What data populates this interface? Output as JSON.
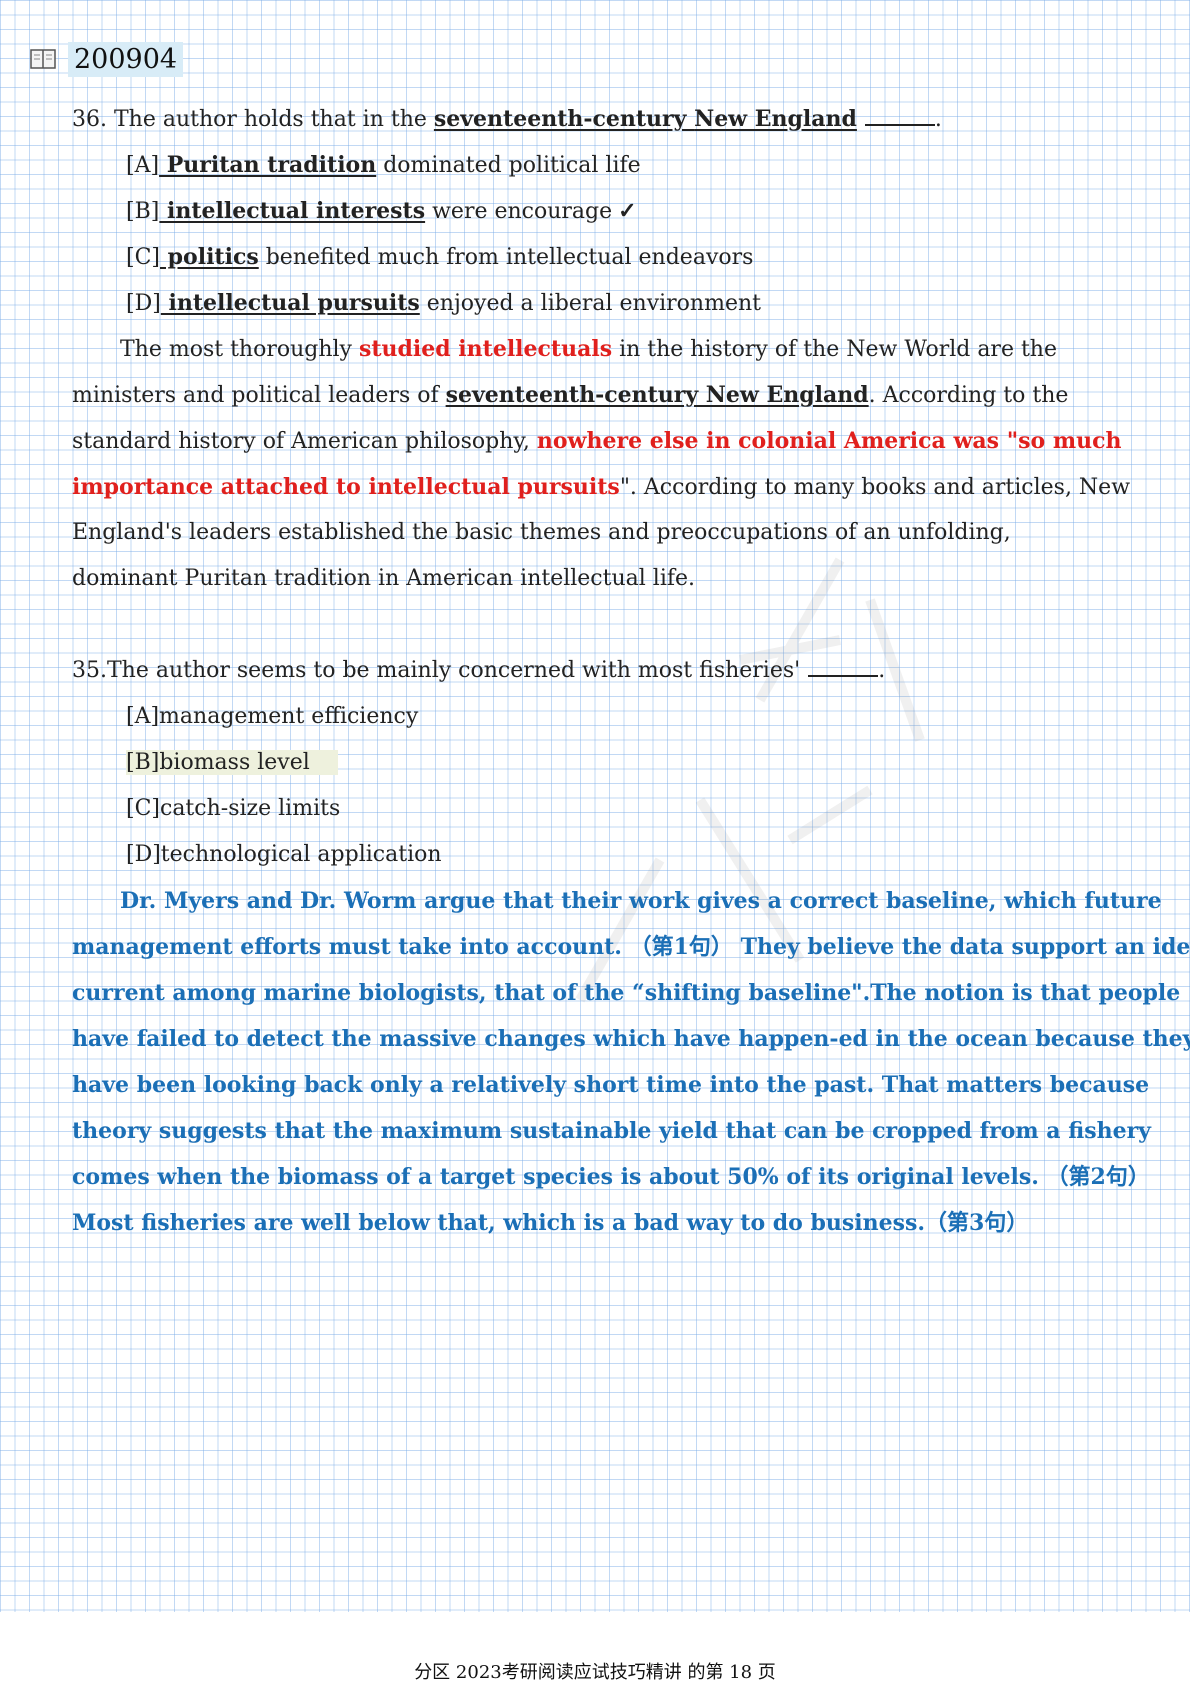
{
  "header": {
    "code": "200904",
    "icon": "book-icon"
  },
  "q36": {
    "stem_pre": "36. The author holds that in the ",
    "stem_u1": "seventeenth-century ",
    "stem_u2": "New England",
    "stem_end": ".",
    "options": [
      {
        "letter": "[A]",
        "key": " Puritan tradition",
        "rest": " dominated political life"
      },
      {
        "letter": "[B]",
        "key": " intellectual interests",
        "rest": " were encourage",
        "mark": "✓"
      },
      {
        "letter": "[C]",
        "key": " politics",
        "rest": " benefited much from intellectual endeavors"
      },
      {
        "letter": "[D]",
        "key": " intellectual pursuits",
        "rest": " enjoyed a liberal environment"
      }
    ],
    "passage": {
      "l1_a": "The most thoroughly ",
      "l1_red": "studied intellectuals",
      "l1_b": " in the history of the New World are the",
      "l2_a": "ministers and political leaders of ",
      "l2_u": "seventeenth-century New England",
      "l2_b": ". According to the",
      "l3_a": "standard history of American philosophy, ",
      "l3_red": "nowhere else in colonial America was \"so much",
      "l4_red": "importance attached to intellectual pursuits",
      "l4_b": "\". According to many books and articles, New",
      "l5": "England's leaders established the basic themes and preoccupations of an unfolding,",
      "l6": "dominant Puritan tradition in American intellectual life."
    }
  },
  "q35": {
    "stem": "35.The author seems to be mainly concerned with most fisheries'",
    "stem_end": ".",
    "options": [
      "[A]management efficiency",
      "[B]biomass level",
      "[C]catch-size limits",
      "[D]technological application"
    ],
    "passage_lines": [
      "Dr. Myers and Dr. Worm argue that their work gives a correct baseline, which future",
      "management efforts must take into account. （第1句） They believe the data support an idea",
      "current among marine biologists, that of the “shifting baseline\".The notion is that people",
      "have failed to detect the massive changes which have happen-ed in the ocean because they",
      "have been looking back only a relatively short time into the past. That matters because",
      "theory suggests that the maximum sustainable yield that can be cropped from a fishery",
      "comes when the biomass of a target species is about 50% of its original levels. （第2句）",
      "Most fisheries are well below that, which is a bad way to do business.（第3句）"
    ]
  },
  "footer": "分区 2023考研阅读应试技巧精讲 的第 18 页"
}
